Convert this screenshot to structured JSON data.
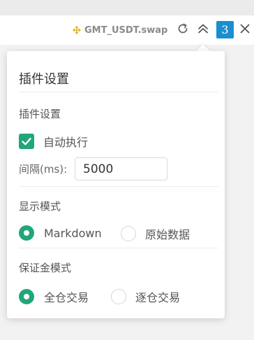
{
  "header": {
    "symbol": "GMT_USDT.swap",
    "symbol_icon": "binance-diamond-icon",
    "count": "3"
  },
  "popup": {
    "title": "插件设置",
    "plugin_section": {
      "title": "插件设置",
      "auto_execute_label": "自动执行",
      "auto_execute_checked": true,
      "interval_label": "间隔(ms):",
      "interval_value": "5000"
    },
    "display_section": {
      "title": "显示模式",
      "options": [
        "Markdown",
        "原始数据"
      ],
      "selected": "Markdown"
    },
    "margin_section": {
      "title": "保证金模式",
      "options": [
        "全仓交易",
        "逐仓交易"
      ],
      "selected": "全仓交易"
    }
  },
  "colors": {
    "accent_green": "#21a67a",
    "badge_blue": "#1a8fcf",
    "binance_yellow": "#e6b830"
  }
}
